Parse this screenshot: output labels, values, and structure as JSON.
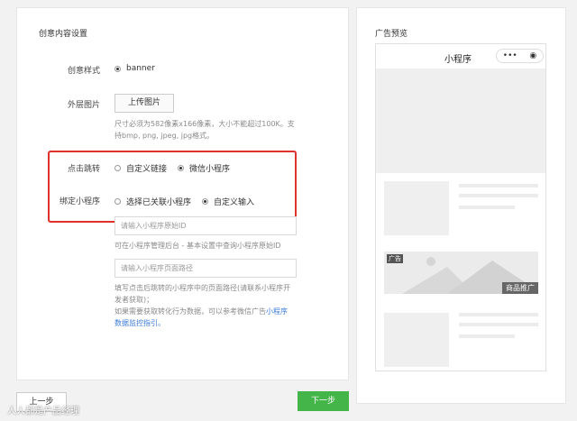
{
  "settings": {
    "title": "创意内容设置",
    "style_label": "创意样式",
    "style_option": "banner",
    "image_label": "外层图片",
    "upload_button": "上传图片",
    "upload_hint_1": "尺寸必须为582像素x166像素，大小不能超过100K。支",
    "upload_hint_2": "持bmp, png, jpeg, jpg格式。",
    "jump_label": "点击跳转",
    "jump_options": [
      "自定义链接",
      "微信小程序"
    ],
    "bind_label": "绑定小程序",
    "bind_options": [
      "选择已关联小程序",
      "自定义输入"
    ],
    "id_placeholder": "请输入小程序原始ID",
    "id_hint": "可在小程序管理后台 - 基本设置中查询小程序原始ID",
    "path_placeholder": "请输入小程序页面路径",
    "path_hint_1": "填写点击后跳转的小程序中的页面路径(请联系小程序开",
    "path_hint_2": "发者获取)；",
    "path_hint_3": "如果需要获取转化行为数据，可以参考微信广告",
    "path_link_1": "小程序",
    "path_link_2": "数据监控指引。"
  },
  "preview": {
    "title": "广告预览",
    "phone_title": "小程序",
    "capsule_more": "•••",
    "capsule_close": "◉",
    "ad_tag": "广告",
    "ad_product": "商品推广"
  },
  "footer": {
    "prev": "上一步",
    "next": "下一步",
    "watermark": "人人都是产品经理"
  },
  "colors": {
    "accent": "#44b549",
    "highlight": "#e0312b",
    "link": "#3a7bd5"
  }
}
